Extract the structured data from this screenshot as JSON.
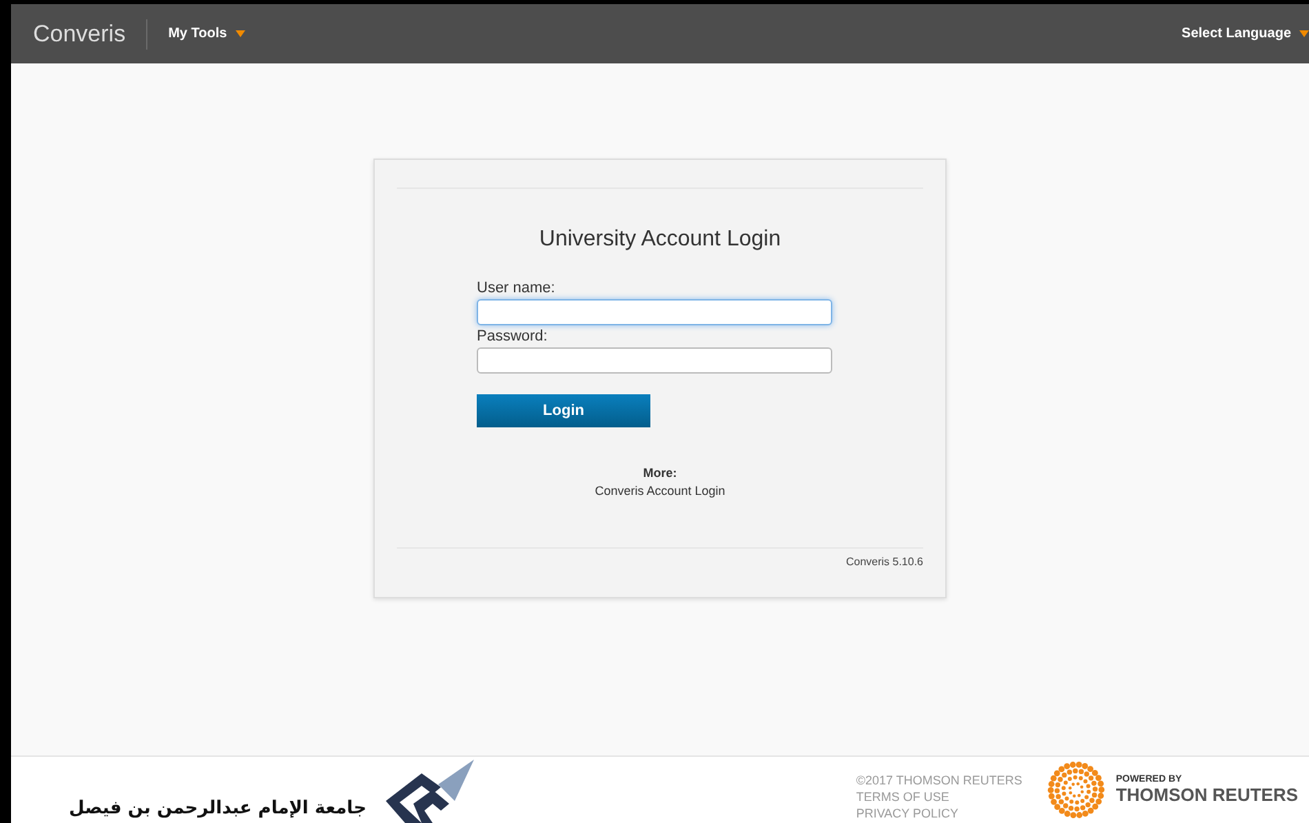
{
  "header": {
    "app_name": "Converis",
    "menu": "My Tools",
    "language": "Select Language"
  },
  "login": {
    "title": "University Account Login",
    "fields": [
      {
        "label": "User name:",
        "focused": true
      },
      {
        "label": "Password:",
        "focused": false
      }
    ],
    "button": "Login",
    "more_heading": "More:",
    "more_link": "Converis Account Login",
    "version": "Converis 5.10.6"
  },
  "footer": {
    "university_name": "جامعة الإمام عبدالرحمن بن فيصل",
    "links": [
      "©2017 THOMSON REUTERS",
      "TERMS OF USE",
      "PRIVACY POLICY"
    ],
    "powered_by": "POWERED BY",
    "brand": "THOMSON REUTERS"
  }
}
